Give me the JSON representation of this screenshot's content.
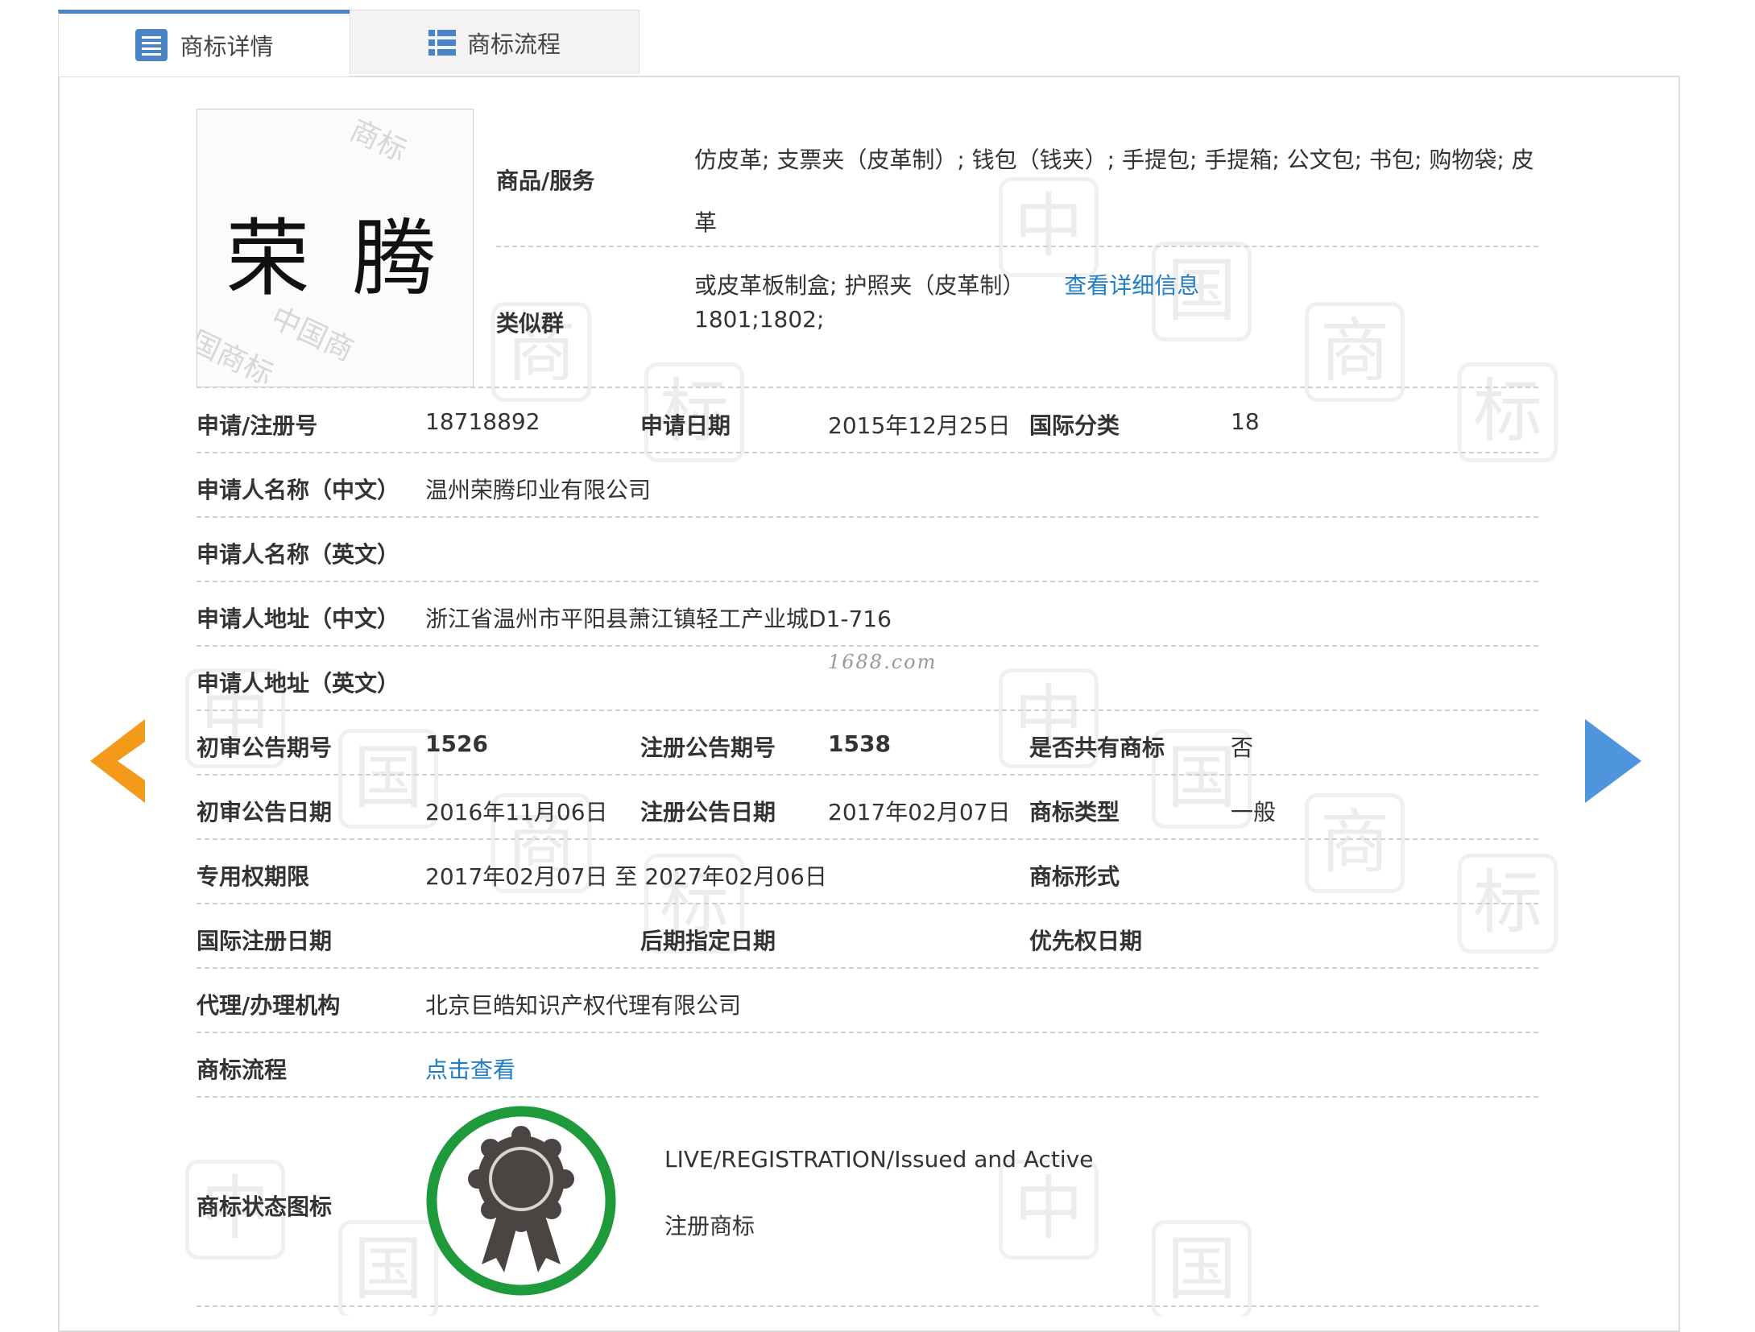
{
  "tabs": [
    {
      "label": "商标详情",
      "icon": "list-doc-icon",
      "active": true
    },
    {
      "label": "商标流程",
      "icon": "list-grid-icon",
      "active": false
    }
  ],
  "trademark": {
    "mark_text": "荣 腾"
  },
  "goods": {
    "label": "商品/服务",
    "line1": "仿皮革; 支票夹（皮革制）; 钱包（钱夹）; 手提包; 手提箱; 公文包; 书包; 购物袋; 皮革",
    "line2": "或皮革板制盒; 护照夹（皮革制）",
    "more_link": "查看详细信息"
  },
  "similar_group": {
    "label": "类似群",
    "value": "1801;1802;"
  },
  "fields": {
    "reg_no_label": "申请/注册号",
    "reg_no": "18718892",
    "apply_date_label": "申请日期",
    "apply_date": "2015年12月25日",
    "intl_class_label": "国际分类",
    "intl_class": "18",
    "applicant_cn_label": "申请人名称（中文）",
    "applicant_cn": "温州荣腾印业有限公司",
    "applicant_en_label": "申请人名称（英文）",
    "applicant_en": "",
    "address_cn_label": "申请人地址（中文）",
    "address_cn": "浙江省温州市平阳县萧江镇轻工产业城D1-716",
    "address_en_label": "申请人地址（英文）",
    "address_en": "",
    "prelim_no_label": "初审公告期号",
    "prelim_no": "1526",
    "reg_pub_no_label": "注册公告期号",
    "reg_pub_no": "1538",
    "shared_label": "是否共有商标",
    "shared": "否",
    "prelim_date_label": "初审公告日期",
    "prelim_date": "2016年11月06日",
    "reg_pub_date_label": "注册公告日期",
    "reg_pub_date": "2017年02月07日",
    "type_label": "商标类型",
    "type": "一般",
    "term_label": "专用权期限",
    "term": "2017年02月07日 至 2027年02月06日",
    "form_label": "商标形式",
    "form": "",
    "intl_reg_date_label": "国际注册日期",
    "intl_reg_date": "",
    "later_date_label": "后期指定日期",
    "later_date": "",
    "priority_label": "优先权日期",
    "priority": "",
    "agency_label": "代理/办理机构",
    "agency": "北京巨皓知识产权代理有限公司",
    "flow_label": "商标流程",
    "flow_link": "点击查看",
    "status_icon_label": "商标状态图标",
    "status_en": "LIVE/REGISTRATION/Issued and Active",
    "status_cn": "注册商标"
  },
  "site_tag": "1688.com",
  "colors": {
    "tab_accent": "#4a84c4",
    "link": "#1f7ec4",
    "arrow_left": "#f39a1b",
    "arrow_right": "#4f95dc",
    "status_ring": "#1f9a3a",
    "badge_dark": "#4a4442"
  }
}
